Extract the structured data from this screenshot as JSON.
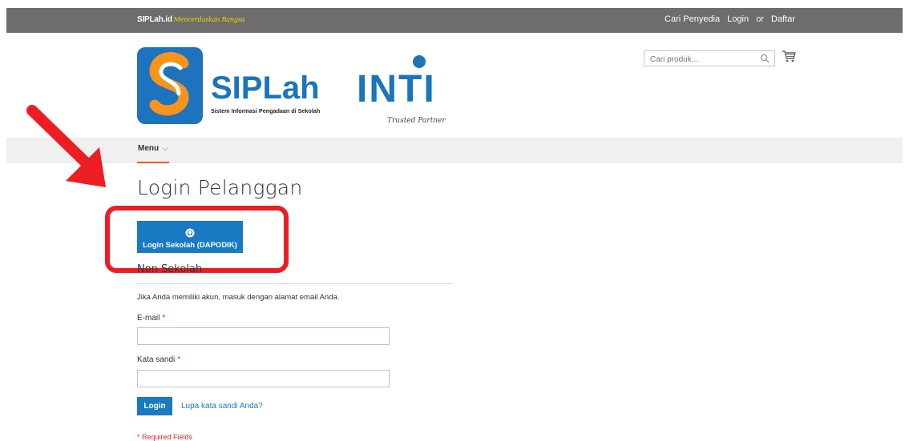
{
  "topbar": {
    "brand": "SIPLah.id",
    "tagline": "Mencerdaskan Bangsa",
    "links": [
      "Cari Penyedia",
      "Login",
      "or",
      "Daftar"
    ]
  },
  "header": {
    "logo_text": "SIPLah",
    "logo_subtitle": "Sistem Informasi Pengadaan di Sekolah",
    "partner_logo_text": "INTI",
    "partner_tagline": "Trusted Partner",
    "search_placeholder": "Cari produk..."
  },
  "menu": {
    "label": "Menu",
    "chevron": "⌵"
  },
  "page": {
    "title": "Login Pelanggan",
    "dapodik_button": "Login Sekolah (DAPODIK)",
    "non_sekolah_heading": "Non Sekolah",
    "info_text": "Jika Anda memiliki akun, masuk dengan alamat email Anda.",
    "email_label": "E-mail",
    "password_label": "Kata sandi",
    "required_mark": "*",
    "login_button": "Login",
    "forgot_link": "Lupa kata sandi Anda?",
    "required_fields_note": "* Required Fields"
  },
  "colors": {
    "topbar": "#6d6d6d",
    "primary_button": "#1979c3",
    "menu_accent": "#ff5501",
    "annotation_red": "#ee1d23"
  },
  "icons": [
    "search-icon",
    "cart-icon",
    "tut-wuri-icon",
    "annotation-arrow"
  ]
}
